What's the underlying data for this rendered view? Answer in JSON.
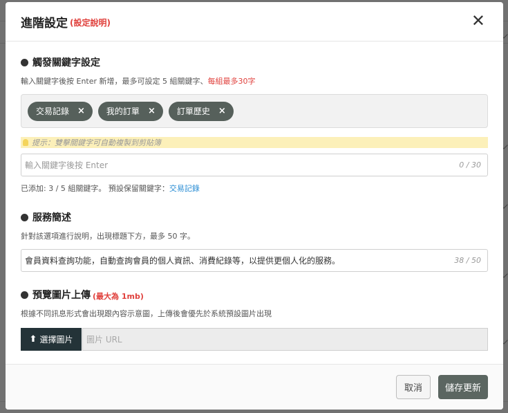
{
  "modal": {
    "title": "進階設定",
    "title_note": "(設定說明)",
    "close_symbol": "✕"
  },
  "keywords": {
    "heading": "觸發關鍵字設定",
    "hint": "輸入關鍵字後按 Enter 新增，最多可設定 5 組關鍵字、",
    "hint_red": "每組最多30字",
    "tags": [
      {
        "label": "交易記錄",
        "remove": "×"
      },
      {
        "label": "我的訂單",
        "remove": "×"
      },
      {
        "label": "訂單歷史",
        "remove": "×"
      }
    ],
    "tip": "提示：雙擊關鍵字可自動複製到剪貼簿",
    "input_placeholder": "輸入關鍵字後按 Enter",
    "counter": "0 / 30",
    "status_text": "已添加: 3 / 5 組關鍵字。 預設保留關鍵字：",
    "reserved_keyword": "交易記錄"
  },
  "description": {
    "heading": "服務簡述",
    "hint": "針對該選項進行說明，出現標題下方，最多 50 字。",
    "value": "會員資料查詢功能，自動查詢會員的個人資訊、消費紀錄等，以提供更個人化的服務。",
    "counter": "38 / 50"
  },
  "image_upload": {
    "heading": "預覽圖片上傳",
    "heading_note": "(最大為 1mb)",
    "hint": "根據不同訊息形式會出現跟內容示意圖，上傳後會優先於系統預設圖片出現",
    "button_label": "選擇圖片",
    "upload_symbol": "⬆",
    "url_placeholder": "圖片 URL"
  },
  "footer": {
    "cancel_label": "取消",
    "save_label": "儲存更新"
  },
  "colors": {
    "tag_bg": "#56605b",
    "accent_red": "#e0413d",
    "link_blue": "#2a8dd4",
    "upload_btn_bg": "#243338",
    "tip_bg": "#fcf0b9"
  }
}
